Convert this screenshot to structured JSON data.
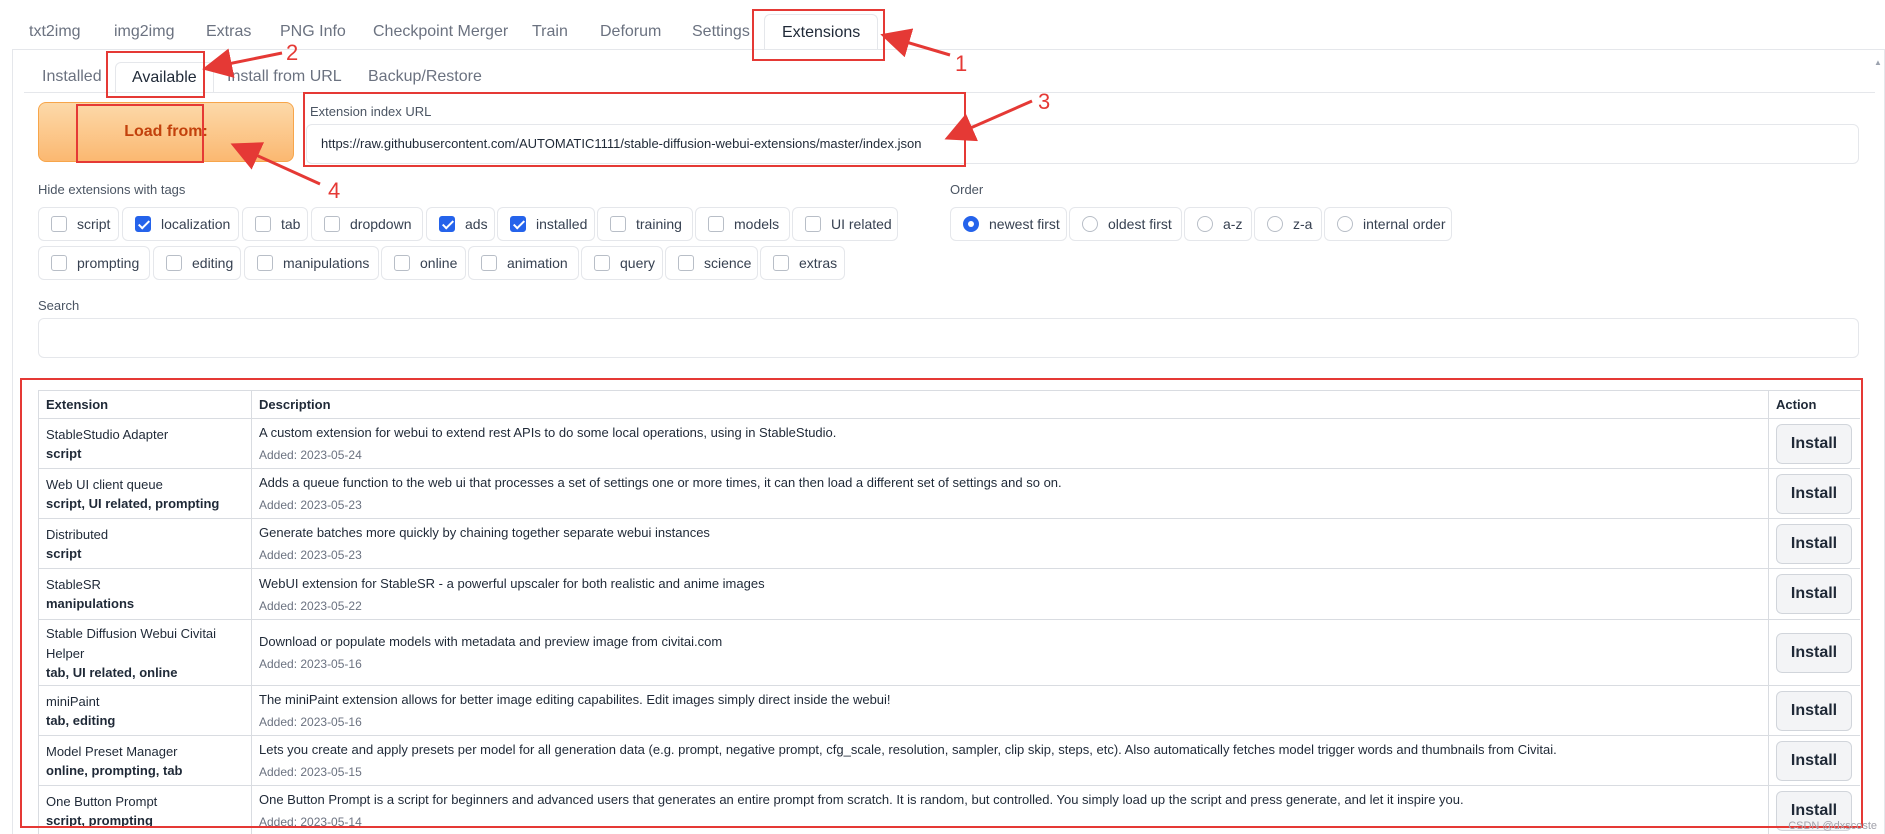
{
  "top_tabs": [
    "txt2img",
    "img2img",
    "Extras",
    "PNG Info",
    "Checkpoint Merger",
    "Train",
    "Deforum",
    "Settings",
    "Extensions"
  ],
  "top_tab_selected": "Extensions",
  "sub_tabs": [
    "Installed",
    "Available",
    "Install from URL",
    "Backup/Restore"
  ],
  "sub_tab_selected": "Available",
  "load_button_label": "Load from:",
  "index_url": {
    "label": "Extension index URL",
    "value": "https://raw.githubusercontent.com/AUTOMATIC1111/stable-diffusion-webui-extensions/master/index.json"
  },
  "hide_tags": {
    "label": "Hide extensions with tags",
    "options": [
      {
        "label": "script",
        "checked": false
      },
      {
        "label": "localization",
        "checked": true
      },
      {
        "label": "tab",
        "checked": false
      },
      {
        "label": "dropdown",
        "checked": false
      },
      {
        "label": "ads",
        "checked": true
      },
      {
        "label": "installed",
        "checked": true
      },
      {
        "label": "training",
        "checked": false
      },
      {
        "label": "models",
        "checked": false
      },
      {
        "label": "UI related",
        "checked": false
      },
      {
        "label": "prompting",
        "checked": false
      },
      {
        "label": "editing",
        "checked": false
      },
      {
        "label": "manipulations",
        "checked": false
      },
      {
        "label": "online",
        "checked": false
      },
      {
        "label": "animation",
        "checked": false
      },
      {
        "label": "query",
        "checked": false
      },
      {
        "label": "science",
        "checked": false
      },
      {
        "label": "extras",
        "checked": false
      }
    ]
  },
  "order": {
    "label": "Order",
    "options": [
      "newest first",
      "oldest first",
      "a-z",
      "z-a",
      "internal order"
    ],
    "selected": "newest first"
  },
  "search": {
    "label": "Search",
    "value": ""
  },
  "table": {
    "headers": [
      "Extension",
      "Description",
      "Action"
    ],
    "rows": [
      {
        "name": "StableStudio Adapter",
        "tags": "script",
        "description": "A custom extension for webui to extend rest APIs to do some local operations, using in StableStudio.",
        "added": "Added: 2023-05-24",
        "action": "Install"
      },
      {
        "name": "Web UI client queue",
        "tags": "script, UI related, prompting",
        "description": "Adds a queue function to the web ui that processes a set of settings one or more times, it can then load a different set of settings and so on.",
        "added": "Added: 2023-05-23",
        "action": "Install"
      },
      {
        "name": "Distributed",
        "tags": "script",
        "description": "Generate batches more quickly by chaining together separate webui instances",
        "added": "Added: 2023-05-23",
        "action": "Install"
      },
      {
        "name": "StableSR",
        "tags": "manipulations",
        "description": "WebUI extension for StableSR - a powerful upscaler for both realistic and anime images",
        "added": "Added: 2023-05-22",
        "action": "Install"
      },
      {
        "name": "Stable Diffusion Webui Civitai Helper",
        "tags": "tab, UI related, online",
        "description": "Download or populate models with metadata and preview image from civitai.com",
        "added": "Added: 2023-05-16",
        "action": "Install"
      },
      {
        "name": "miniPaint",
        "tags": "tab, editing",
        "description": "The miniPaint extension allows for better image editing capabilites. Edit images simply direct inside the webui!",
        "added": "Added: 2023-05-16",
        "action": "Install"
      },
      {
        "name": "Model Preset Manager",
        "tags": "online, prompting, tab",
        "description": "Lets you create and apply presets per model for all generation data (e.g. prompt, negative prompt, cfg_scale, resolution, sampler, clip skip, steps, etc). Also automatically fetches model trigger words and thumbnails from Civitai.",
        "added": "Added: 2023-05-15",
        "action": "Install"
      },
      {
        "name": "One Button Prompt",
        "tags": "script, prompting",
        "description": "One Button Prompt is a script for beginners and advanced users that generates an entire prompt from scratch. It is random, but controlled. You simply load up the script and press generate, and let it inspire you.",
        "added": "Added: 2023-05-14",
        "action": "Install"
      }
    ]
  },
  "annotations": [
    "1",
    "2",
    "3",
    "4"
  ],
  "watermark": "CSDN @dxscoste",
  "colors": {
    "annotation": "#e53935",
    "accent": "#2563eb",
    "load_button": "#fbb871"
  }
}
